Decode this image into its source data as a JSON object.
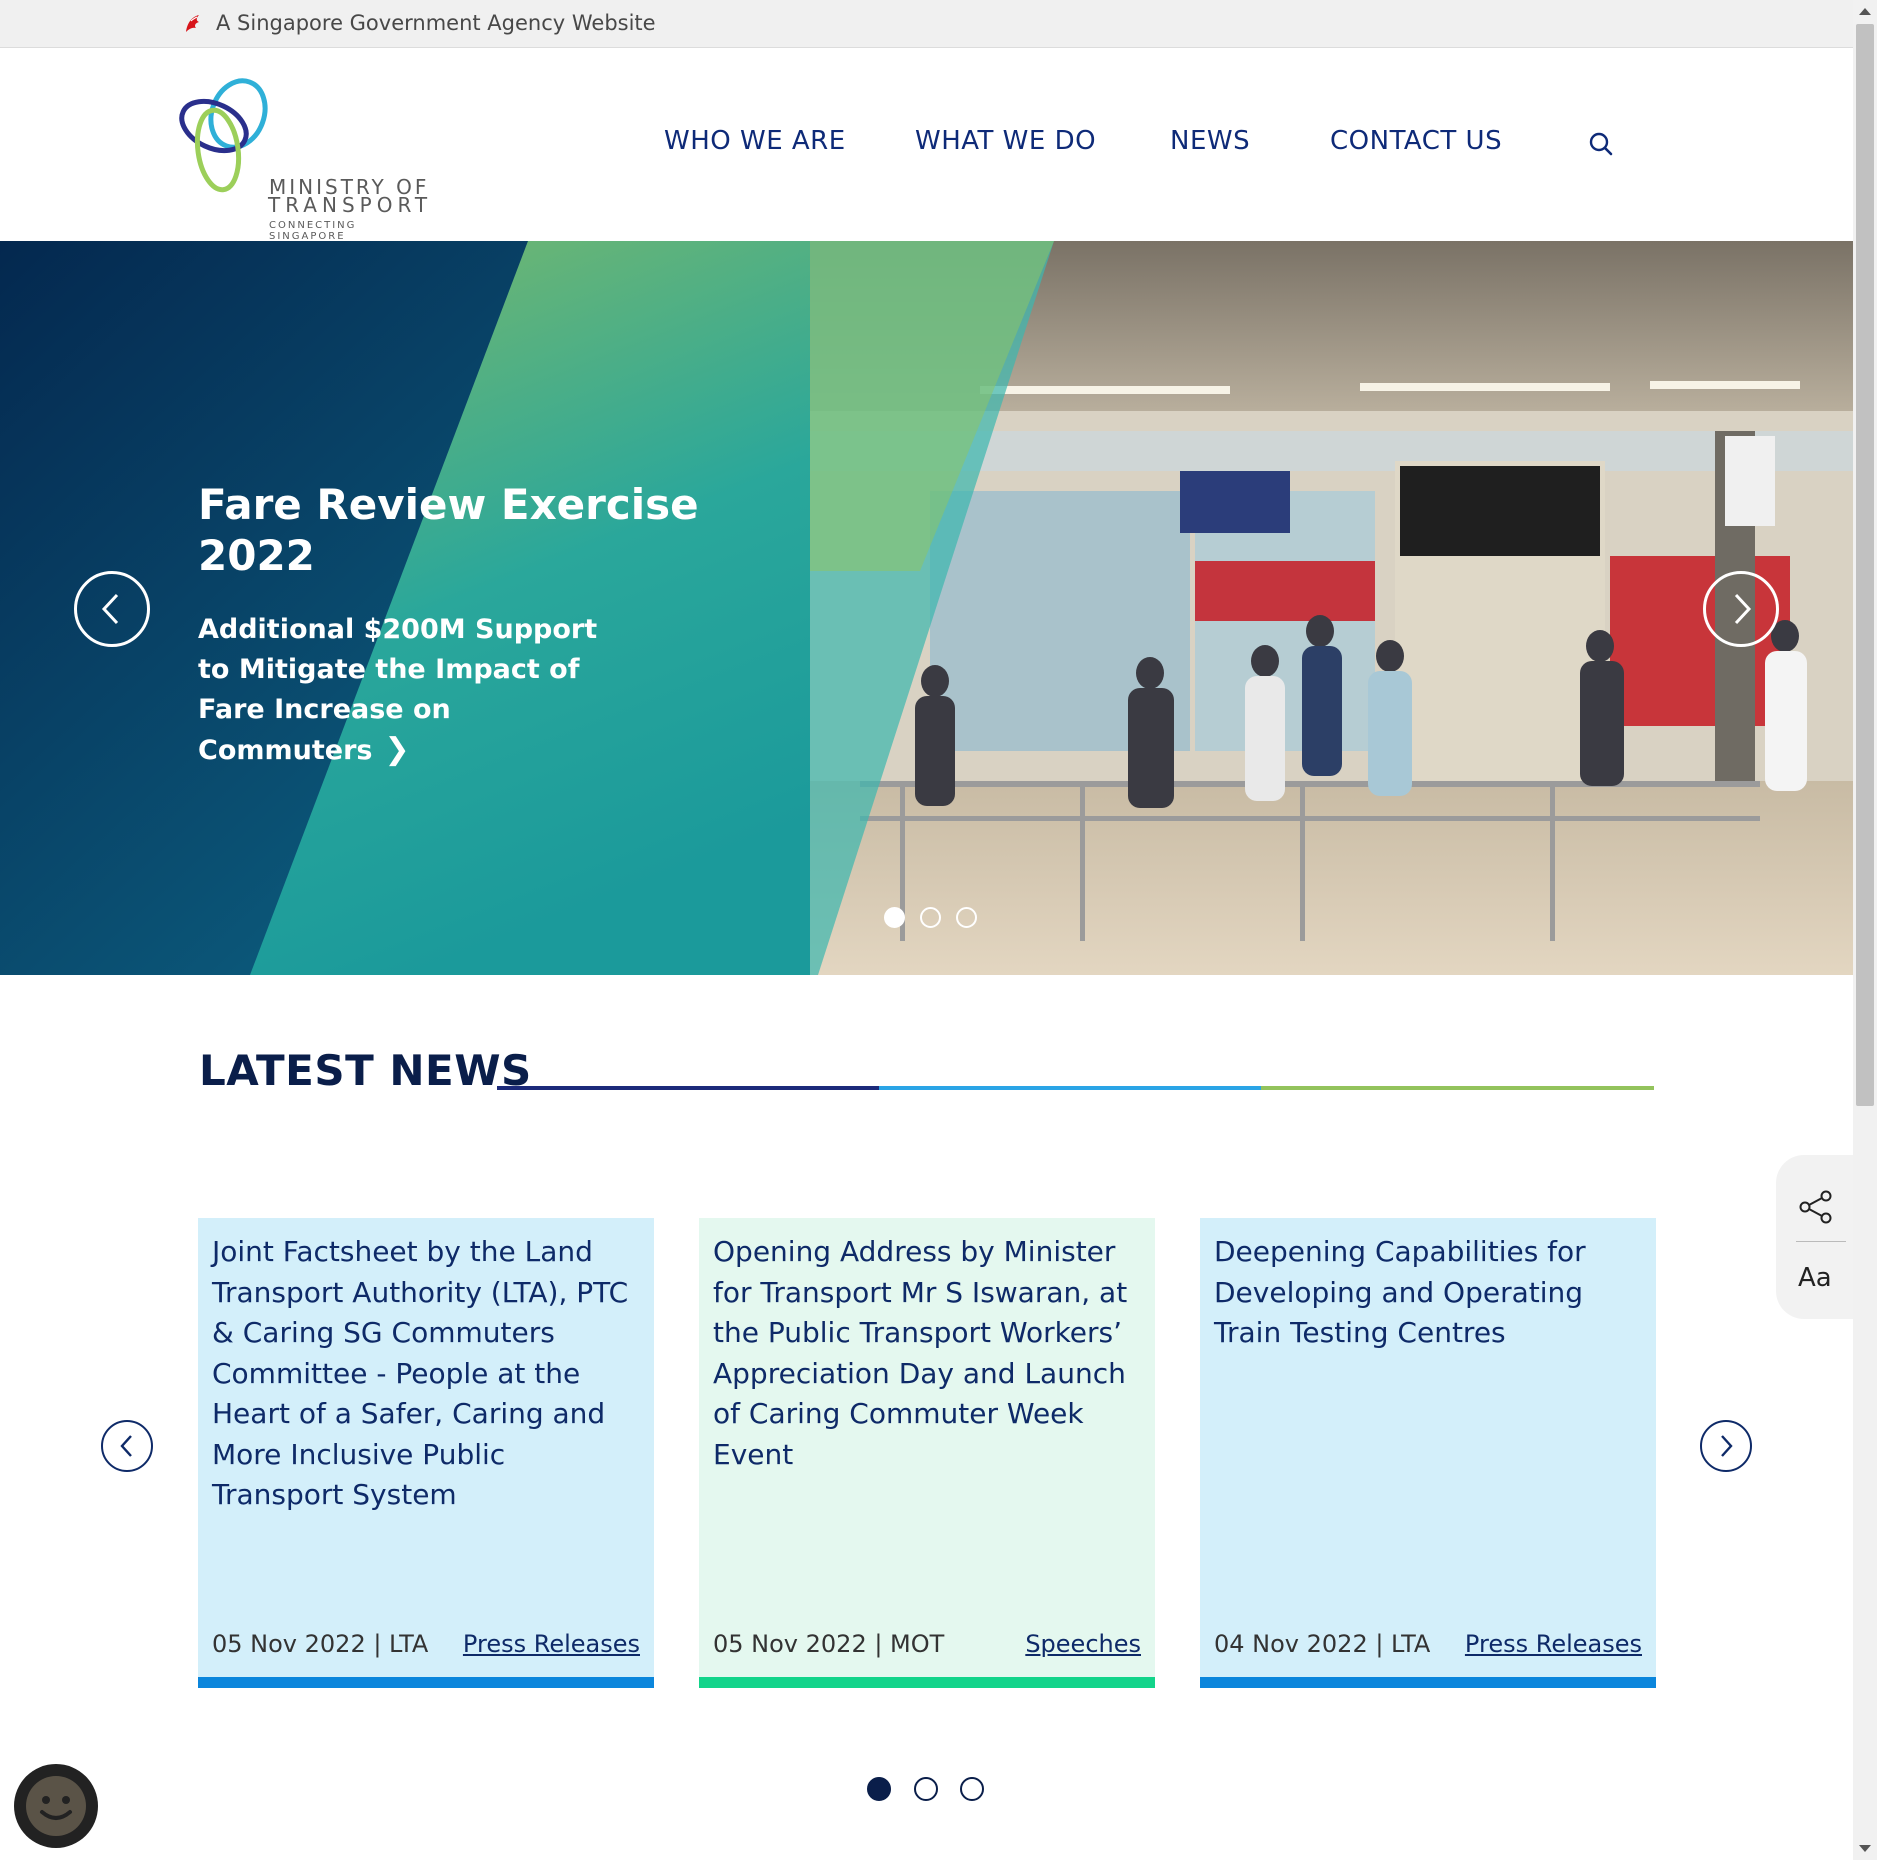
{
  "masthead": {
    "text": "A Singapore Government Agency Website",
    "icon": "singapore-lion-icon"
  },
  "logo": {
    "line1": "MINISTRY OF",
    "line2": "TRANSPORT",
    "line3": "CONNECTING SINGAPORE"
  },
  "nav": {
    "items": [
      "WHO WE ARE",
      "WHAT WE DO",
      "NEWS",
      "CONTACT US"
    ],
    "search_icon": "search-icon"
  },
  "hero": {
    "title": "Fare Review Exercise 2022",
    "subtitle": "Additional $200M Support to Mitigate the Impact of Fare Increase on Commuters",
    "subtitle_chevron": "❯",
    "slide_count": 3,
    "active_slide": 1,
    "prev_icon": "chevron-left-icon",
    "next_icon": "chevron-right-icon"
  },
  "latest_news": {
    "heading": "LATEST NEWS",
    "cards": [
      {
        "title": "Joint Factsheet by the Land Transport Authority (LTA), PTC & Caring SG Commuters Committee - People at the Heart of a Safer, Caring and More Inclusive Public Transport System",
        "meta": "05 Nov 2022 | LTA",
        "category": "Press Releases"
      },
      {
        "title": "Opening Address by Minister for Transport Mr S Iswaran, at the Public Transport Workers’ Appreciation Day and Launch of Caring Commuter Week Event",
        "meta": "05 Nov 2022 | MOT",
        "category": "Speeches"
      },
      {
        "title": "Deepening Capabilities for Developing and Operating Train Testing Centres",
        "meta": "04 Nov 2022 | LTA",
        "category": "Press Releases"
      }
    ],
    "page_count": 3,
    "active_page": 1
  },
  "side_widget": {
    "share_icon": "share-icon",
    "font_size_label": "Aa"
  },
  "chatbot": {
    "icon": "chatbot-smiley-icon"
  },
  "colors": {
    "navy": "#0e2a78",
    "card_blue_bg": "#d3effa",
    "card_green_bg": "#e4f8ef",
    "bar_blue": "#0b86dc",
    "bar_green": "#12d48a",
    "rule_navy": "#1c2a7a",
    "rule_blue": "#2aa4e6",
    "rule_green": "#93c35c"
  }
}
